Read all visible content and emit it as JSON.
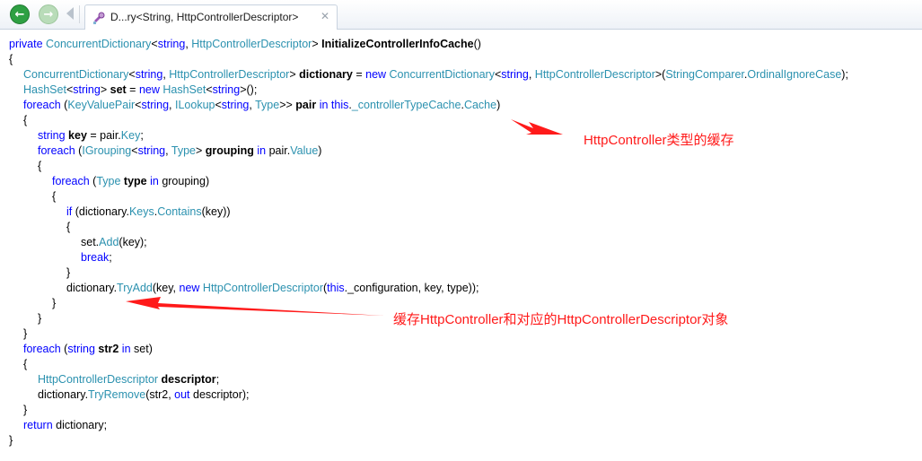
{
  "tab": {
    "title": "D...ry<String, HttpControllerDescriptor>",
    "close_glyph": "✕"
  },
  "nav": {
    "back_glyph": "←",
    "forward_glyph": "→"
  },
  "code_lines": [
    {
      "indent": 0,
      "tokens": [
        {
          "t": "private ",
          "c": "kw"
        },
        {
          "t": "ConcurrentDictionary",
          "c": "ty"
        },
        {
          "t": "<",
          "c": "pl"
        },
        {
          "t": "string",
          "c": "kw"
        },
        {
          "t": ", ",
          "c": "pl"
        },
        {
          "t": "HttpControllerDescriptor",
          "c": "ty"
        },
        {
          "t": "> ",
          "c": "pl"
        },
        {
          "t": "InitializeControllerInfoCache",
          "c": "bd"
        },
        {
          "t": "()",
          "c": "pl"
        }
      ]
    },
    {
      "indent": 0,
      "tokens": [
        {
          "t": "{",
          "c": "pl"
        }
      ]
    },
    {
      "indent": 1,
      "tokens": [
        {
          "t": "ConcurrentDictionary",
          "c": "ty"
        },
        {
          "t": "<",
          "c": "pl"
        },
        {
          "t": "string",
          "c": "kw"
        },
        {
          "t": ", ",
          "c": "pl"
        },
        {
          "t": "HttpControllerDescriptor",
          "c": "ty"
        },
        {
          "t": "> ",
          "c": "pl"
        },
        {
          "t": "dictionary",
          "c": "bd"
        },
        {
          "t": " = ",
          "c": "pl"
        },
        {
          "t": "new ",
          "c": "kw"
        },
        {
          "t": "ConcurrentDictionary",
          "c": "ty"
        },
        {
          "t": "<",
          "c": "pl"
        },
        {
          "t": "string",
          "c": "kw"
        },
        {
          "t": ", ",
          "c": "pl"
        },
        {
          "t": "HttpControllerDescriptor",
          "c": "ty"
        },
        {
          "t": ">(",
          "c": "pl"
        },
        {
          "t": "StringComparer",
          "c": "ty"
        },
        {
          "t": ".",
          "c": "pl"
        },
        {
          "t": "OrdinalIgnoreCase",
          "c": "ty"
        },
        {
          "t": ");",
          "c": "pl"
        }
      ]
    },
    {
      "indent": 1,
      "tokens": [
        {
          "t": "HashSet",
          "c": "ty"
        },
        {
          "t": "<",
          "c": "pl"
        },
        {
          "t": "string",
          "c": "kw"
        },
        {
          "t": "> ",
          "c": "pl"
        },
        {
          "t": "set",
          "c": "bd"
        },
        {
          "t": " = ",
          "c": "pl"
        },
        {
          "t": "new ",
          "c": "kw"
        },
        {
          "t": "HashSet",
          "c": "ty"
        },
        {
          "t": "<",
          "c": "pl"
        },
        {
          "t": "string",
          "c": "kw"
        },
        {
          "t": ">();",
          "c": "pl"
        }
      ]
    },
    {
      "indent": 1,
      "tokens": [
        {
          "t": "foreach ",
          "c": "kw"
        },
        {
          "t": "(",
          "c": "pl"
        },
        {
          "t": "KeyValuePair",
          "c": "ty"
        },
        {
          "t": "<",
          "c": "pl"
        },
        {
          "t": "string",
          "c": "kw"
        },
        {
          "t": ", ",
          "c": "pl"
        },
        {
          "t": "ILookup",
          "c": "ty"
        },
        {
          "t": "<",
          "c": "pl"
        },
        {
          "t": "string",
          "c": "kw"
        },
        {
          "t": ", ",
          "c": "pl"
        },
        {
          "t": "Type",
          "c": "ty"
        },
        {
          "t": ">> ",
          "c": "pl"
        },
        {
          "t": "pair",
          "c": "bd"
        },
        {
          "t": " in ",
          "c": "kw"
        },
        {
          "t": "this",
          "c": "kw"
        },
        {
          "t": ".",
          "c": "pl"
        },
        {
          "t": "_controllerTypeCache",
          "c": "ty"
        },
        {
          "t": ".",
          "c": "pl"
        },
        {
          "t": "Cache",
          "c": "ty"
        },
        {
          "t": ")",
          "c": "pl"
        }
      ]
    },
    {
      "indent": 1,
      "tokens": [
        {
          "t": "{",
          "c": "pl"
        }
      ]
    },
    {
      "indent": 2,
      "tokens": [
        {
          "t": "string ",
          "c": "kw"
        },
        {
          "t": "key",
          "c": "bd"
        },
        {
          "t": " = pair.",
          "c": "pl"
        },
        {
          "t": "Key",
          "c": "ty"
        },
        {
          "t": ";",
          "c": "pl"
        }
      ]
    },
    {
      "indent": 2,
      "tokens": [
        {
          "t": "foreach ",
          "c": "kw"
        },
        {
          "t": "(",
          "c": "pl"
        },
        {
          "t": "IGrouping",
          "c": "ty"
        },
        {
          "t": "<",
          "c": "pl"
        },
        {
          "t": "string",
          "c": "kw"
        },
        {
          "t": ", ",
          "c": "pl"
        },
        {
          "t": "Type",
          "c": "ty"
        },
        {
          "t": "> ",
          "c": "pl"
        },
        {
          "t": "grouping",
          "c": "bd"
        },
        {
          "t": " in ",
          "c": "kw"
        },
        {
          "t": "pair.",
          "c": "pl"
        },
        {
          "t": "Value",
          "c": "ty"
        },
        {
          "t": ")",
          "c": "pl"
        }
      ]
    },
    {
      "indent": 2,
      "tokens": [
        {
          "t": "{",
          "c": "pl"
        }
      ]
    },
    {
      "indent": 3,
      "tokens": [
        {
          "t": "foreach ",
          "c": "kw"
        },
        {
          "t": "(",
          "c": "pl"
        },
        {
          "t": "Type ",
          "c": "ty"
        },
        {
          "t": "type",
          "c": "bd"
        },
        {
          "t": " in ",
          "c": "kw"
        },
        {
          "t": "grouping)",
          "c": "pl"
        }
      ]
    },
    {
      "indent": 3,
      "tokens": [
        {
          "t": "{",
          "c": "pl"
        }
      ]
    },
    {
      "indent": 4,
      "tokens": [
        {
          "t": "if ",
          "c": "kw"
        },
        {
          "t": "(dictionary.",
          "c": "pl"
        },
        {
          "t": "Keys",
          "c": "ty"
        },
        {
          "t": ".",
          "c": "pl"
        },
        {
          "t": "Contains",
          "c": "ty"
        },
        {
          "t": "(key))",
          "c": "pl"
        }
      ]
    },
    {
      "indent": 4,
      "tokens": [
        {
          "t": "{",
          "c": "pl"
        }
      ]
    },
    {
      "indent": 5,
      "tokens": [
        {
          "t": "set.",
          "c": "pl"
        },
        {
          "t": "Add",
          "c": "ty"
        },
        {
          "t": "(key);",
          "c": "pl"
        }
      ]
    },
    {
      "indent": 5,
      "tokens": [
        {
          "t": "break",
          "c": "kw"
        },
        {
          "t": ";",
          "c": "pl"
        }
      ]
    },
    {
      "indent": 4,
      "tokens": [
        {
          "t": "}",
          "c": "pl"
        }
      ]
    },
    {
      "indent": 4,
      "tokens": [
        {
          "t": "dictionary.",
          "c": "pl"
        },
        {
          "t": "TryAdd",
          "c": "ty"
        },
        {
          "t": "(key, ",
          "c": "pl"
        },
        {
          "t": "new ",
          "c": "kw"
        },
        {
          "t": "HttpControllerDescriptor",
          "c": "ty"
        },
        {
          "t": "(",
          "c": "pl"
        },
        {
          "t": "this",
          "c": "kw"
        },
        {
          "t": "._configuration, key, type));",
          "c": "pl"
        }
      ]
    },
    {
      "indent": 3,
      "tokens": [
        {
          "t": "}",
          "c": "pl"
        }
      ]
    },
    {
      "indent": 2,
      "tokens": [
        {
          "t": "}",
          "c": "pl"
        }
      ]
    },
    {
      "indent": 1,
      "tokens": [
        {
          "t": "}",
          "c": "pl"
        }
      ]
    },
    {
      "indent": 1,
      "tokens": [
        {
          "t": "foreach ",
          "c": "kw"
        },
        {
          "t": "(",
          "c": "pl"
        },
        {
          "t": "string ",
          "c": "kw"
        },
        {
          "t": "str2",
          "c": "bd"
        },
        {
          "t": " in ",
          "c": "kw"
        },
        {
          "t": "set)",
          "c": "pl"
        }
      ]
    },
    {
      "indent": 1,
      "tokens": [
        {
          "t": "{",
          "c": "pl"
        }
      ]
    },
    {
      "indent": 2,
      "tokens": [
        {
          "t": "HttpControllerDescriptor ",
          "c": "ty"
        },
        {
          "t": "descriptor",
          "c": "bd"
        },
        {
          "t": ";",
          "c": "pl"
        }
      ]
    },
    {
      "indent": 2,
      "tokens": [
        {
          "t": "dictionary.",
          "c": "pl"
        },
        {
          "t": "TryRemove",
          "c": "ty"
        },
        {
          "t": "(str2, ",
          "c": "pl"
        },
        {
          "t": "out ",
          "c": "kw"
        },
        {
          "t": "descriptor);",
          "c": "pl"
        }
      ]
    },
    {
      "indent": 1,
      "tokens": [
        {
          "t": "}",
          "c": "pl"
        }
      ]
    },
    {
      "indent": 1,
      "tokens": [
        {
          "t": "return ",
          "c": "kw"
        },
        {
          "t": "dictionary;",
          "c": "pl"
        }
      ]
    },
    {
      "indent": 0,
      "tokens": [
        {
          "t": "}",
          "c": "pl"
        }
      ]
    }
  ],
  "annotations": {
    "first": "HttpController类型的缓存",
    "second": "缓存HttpController和对应的HttpControllerDescriptor对象"
  },
  "colors": {
    "keyword": "#0000ff",
    "type": "#2b91af",
    "annotation": "#ff1a1a"
  }
}
